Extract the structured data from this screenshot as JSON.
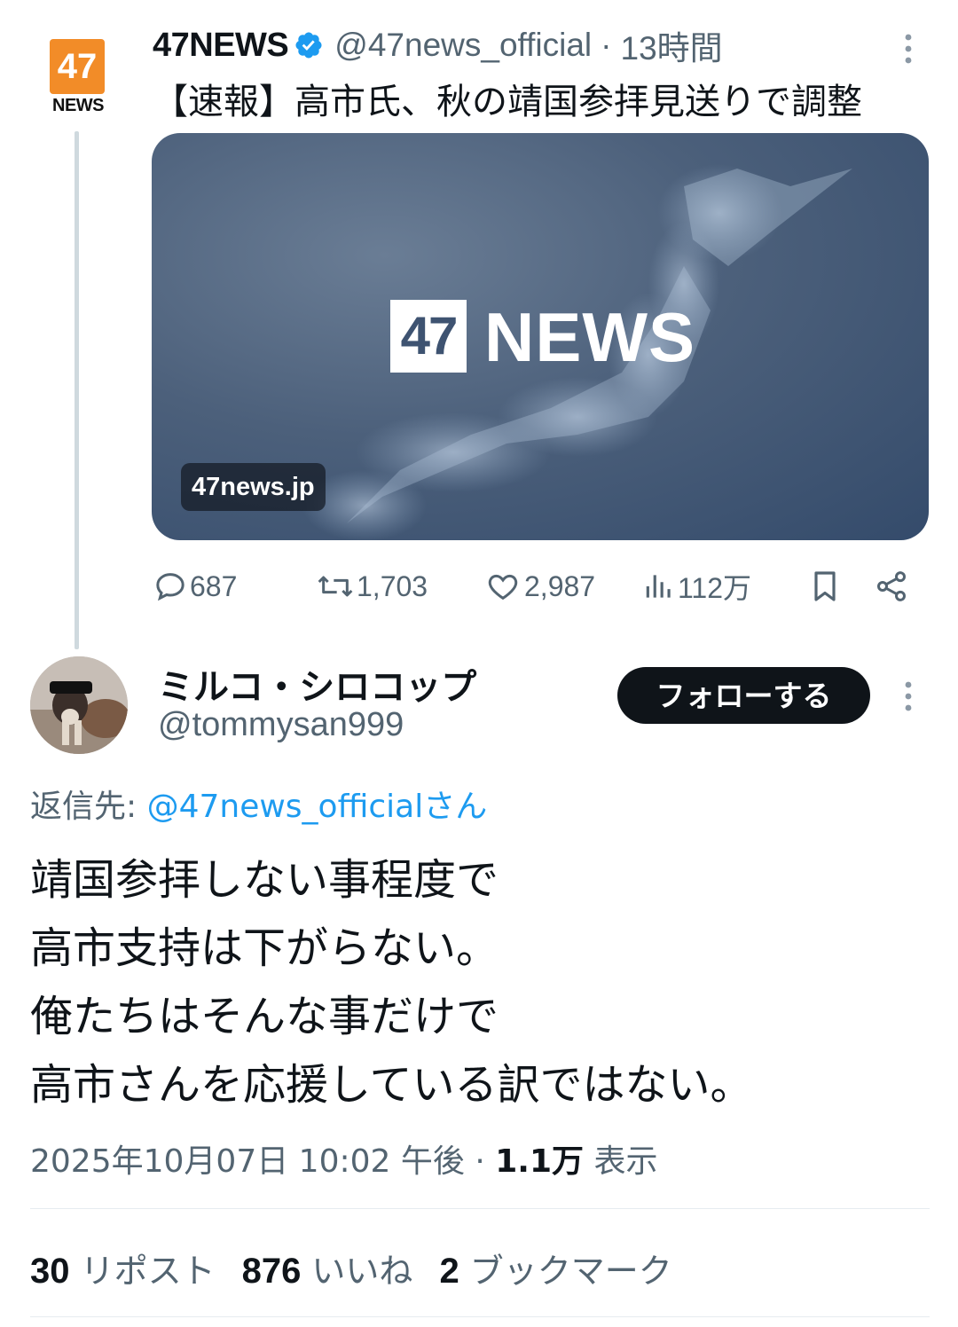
{
  "parent_tweet": {
    "avatar": {
      "number": "47",
      "label": "NEWS"
    },
    "name": "47NEWS",
    "handle": "@47news_official",
    "separator": "·",
    "time": "13時間",
    "text": "【速報】高市氏、秋の靖国参拝見送りで調整",
    "card": {
      "logo_number": "47",
      "logo_text": "NEWS",
      "domain": "47news.jp"
    },
    "actions": {
      "replies": "687",
      "reposts": "1,703",
      "likes": "2,987",
      "views": "112万"
    }
  },
  "reply_tweet": {
    "name": "ミルコ・シロコップ",
    "handle": "@tommysan999",
    "follow_label": "フォローする",
    "reply_to_prefix": "返信先: ",
    "reply_to_handle": "@47news_officialさん",
    "body_lines": [
      "靖国参拝しない事程度で",
      "高市支持は下がらない。",
      "俺たちはそんな事だけで",
      "高市さんを応援している訳ではない。"
    ],
    "timestamp": "2025年10月07日 10:02 午後",
    "separator": " · ",
    "views_count": "1.1万",
    "views_label": " 表示",
    "stats": {
      "reposts_count": "30",
      "reposts_label": " リポスト",
      "likes_count": "876",
      "likes_label": " いいね",
      "bookmarks_count": "2",
      "bookmarks_label": " ブックマーク"
    }
  },
  "colors": {
    "text_primary": "#0f1419",
    "text_secondary": "#536471",
    "link": "#1d9bf0",
    "verified": "#1d9bf0",
    "avatar_orange": "#f28c28"
  }
}
